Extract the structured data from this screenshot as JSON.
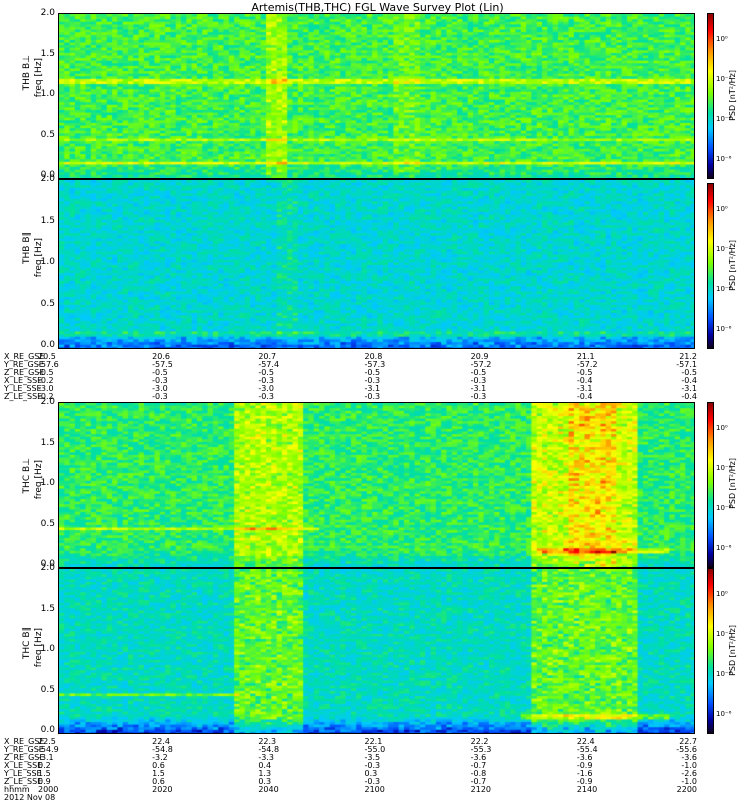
{
  "title": "Artemis(THB,THC) FGL Wave Survey Plot (Lin)",
  "colorbar": {
    "label": "PSD [nT²/Hz]",
    "ticks": [
      "10⁰",
      "10⁻²",
      "10⁻⁴",
      "10⁻⁶"
    ],
    "colors": [
      "#10001a",
      "#0000a0",
      "#0050ff",
      "#00c8ff",
      "#00e0a0",
      "#7fff00",
      "#ffff00",
      "#ff8c00",
      "#ff0000",
      "#8b0000"
    ]
  },
  "yticks": [
    "2.0",
    "1.5",
    "1.0",
    "0.5",
    "0.0"
  ],
  "chart_data": [
    {
      "type": "heatmap",
      "panel": "THB B_perp",
      "ylabel": "THB B⊥",
      "ylabel2": "freq [Hz]",
      "ylim": [
        0,
        2.0
      ],
      "colorscale": "log",
      "zlim_exp": [
        -7,
        1
      ]
    },
    {
      "type": "heatmap",
      "panel": "THB B_par",
      "ylabel": "THB B∥",
      "ylabel2": "freq [Hz]",
      "ylim": [
        0,
        2.0
      ],
      "colorscale": "log",
      "zlim_exp": [
        -7,
        1
      ]
    },
    {
      "type": "heatmap",
      "panel": "THC B_perp",
      "ylabel": "THC B⊥",
      "ylabel2": "freq [Hz]",
      "ylim": [
        0,
        2.0
      ],
      "colorscale": "log",
      "zlim_exp": [
        -7,
        1
      ]
    },
    {
      "type": "heatmap",
      "panel": "THC B_par",
      "ylabel": "THC B∥",
      "ylabel2": "freq [Hz]",
      "ylim": [
        0,
        2.0
      ],
      "colorscale": "log",
      "zlim_exp": [
        -7,
        1
      ]
    }
  ],
  "thb_axis": {
    "labels": [
      "X_RE_GSE",
      "Y_RE_GSE",
      "Z_RE_GSE",
      "X_LE_SSE",
      "Y_LE_SSE",
      "Z_LE_SSE"
    ],
    "columns": [
      [
        "20.5",
        "-57.6",
        "-0.5",
        "-0.2",
        "-3.0",
        "-0.2"
      ],
      [
        "20.6",
        "-57.5",
        "-0.5",
        "-0.3",
        "-3.0",
        "-0.3"
      ],
      [
        "20.7",
        "-57.4",
        "-0.5",
        "-0.3",
        "-3.0",
        "-0.3"
      ],
      [
        "20.8",
        "-57.3",
        "-0.5",
        "-0.3",
        "-3.1",
        "-0.3"
      ],
      [
        "20.9",
        "-57.2",
        "-0.5",
        "-0.3",
        "-3.1",
        "-0.3"
      ],
      [
        "21.1",
        "-57.2",
        "-0.5",
        "-0.4",
        "-3.1",
        "-0.4"
      ],
      [
        "21.2",
        "-57.1",
        "-0.5",
        "-0.4",
        "-3.1",
        "-0.4"
      ]
    ]
  },
  "thc_axis": {
    "labels": [
      "X_RE_GSE",
      "Y_RE_GSE",
      "Z_RE_GSE",
      "X_LE_SSE",
      "Y_LE_SSE",
      "Z_LE_SSE",
      "hhmm",
      "2012 Nov 08"
    ],
    "columns": [
      [
        "22.5",
        "-54.9",
        "-3.1",
        "0.2",
        "1.5",
        "0.9",
        "2000"
      ],
      [
        "22.4",
        "-54.8",
        "-3.2",
        "0.6",
        "1.5",
        "0.6",
        "2020"
      ],
      [
        "22.3",
        "-54.8",
        "-3.3",
        "0.4",
        "1.3",
        "0.3",
        "2040"
      ],
      [
        "22.1",
        "-55.0",
        "-3.5",
        "-0.3",
        "0.3",
        "-0.3",
        "2100"
      ],
      [
        "22.2",
        "-55.3",
        "-3.6",
        "-0.7",
        "-0.8",
        "-0.7",
        "2120"
      ],
      [
        "22.4",
        "-55.4",
        "-3.6",
        "-0.9",
        "-1.6",
        "-0.9",
        "2140"
      ],
      [
        "22.7",
        "-55.6",
        "-3.6",
        "-1.0",
        "-2.6",
        "-1.0",
        "2200"
      ]
    ]
  }
}
